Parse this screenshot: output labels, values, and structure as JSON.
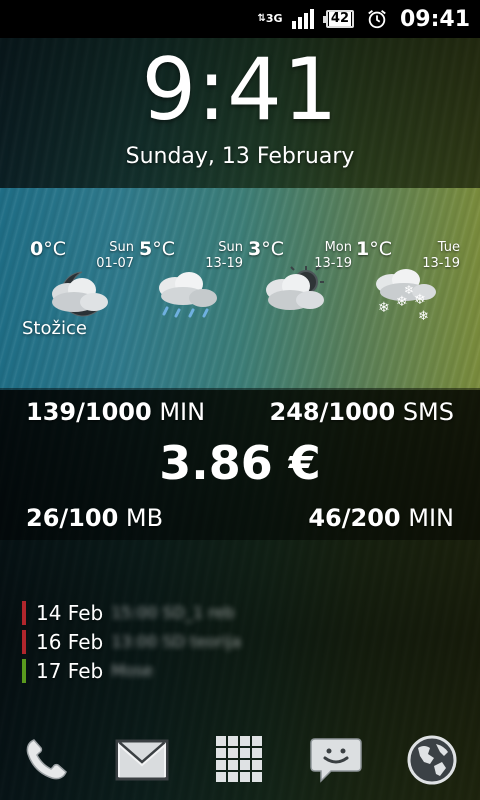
{
  "status_bar": {
    "network": "3G",
    "battery_level": "42",
    "time": "09:41",
    "icons": [
      "data-3g-icon",
      "signal-icon",
      "battery-icon",
      "alarm-clock-icon"
    ]
  },
  "clock": {
    "time": "9:41",
    "date": "Sunday, 13 February"
  },
  "weather": {
    "location": "Stožice",
    "unit": "°C",
    "days": [
      {
        "temp": "0",
        "day": "Sun",
        "range": "01-07",
        "icon": "night-cloudy-icon"
      },
      {
        "temp": "5",
        "day": "Sun",
        "range": "13-19",
        "icon": "rain-cloud-icon"
      },
      {
        "temp": "3",
        "day": "Mon",
        "range": "13-19",
        "icon": "partly-cloudy-icon"
      },
      {
        "temp": "1",
        "day": "Tue",
        "range": "13-19",
        "icon": "snow-cloud-icon"
      }
    ]
  },
  "usage": {
    "calls_used": "139/1000",
    "calls_unit": "MIN",
    "sms_used": "248/1000",
    "sms_unit": "SMS",
    "balance": "3.86 €",
    "data_used": "26/100",
    "data_unit": "MB",
    "calls2_used": "46/200",
    "calls2_unit": "MIN"
  },
  "agenda": {
    "events": [
      {
        "date": "14 Feb",
        "title": "15:00 SD_1 reb",
        "color": "#b0262c"
      },
      {
        "date": "16 Feb",
        "title": "13:00 SD teorija",
        "color": "#b0262c"
      },
      {
        "date": "17 Feb",
        "title": "Mose",
        "color": "#5a9a1e"
      }
    ]
  },
  "dock": {
    "items": [
      "phone-icon",
      "gmail-icon",
      "app-drawer-icon",
      "messaging-icon",
      "browser-globe-icon"
    ]
  }
}
